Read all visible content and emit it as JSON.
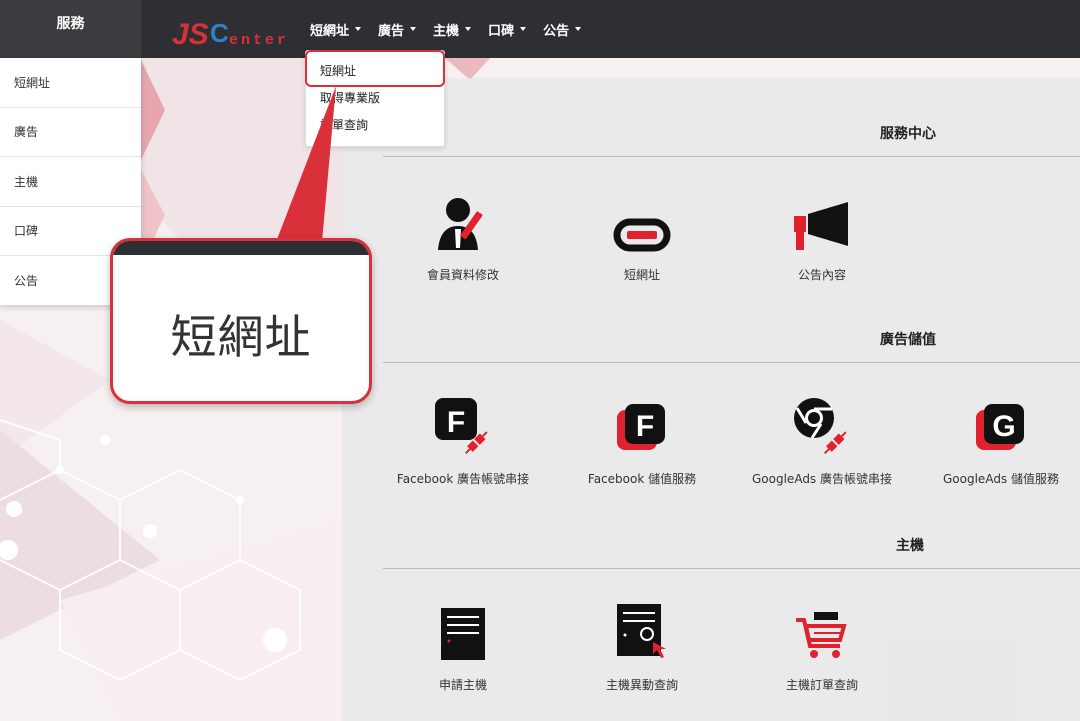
{
  "topbar": {
    "sidebar_title": "服務",
    "logo_text_1": "JS",
    "logo_text_2": "C",
    "logo_text_3": "enter",
    "nav": [
      {
        "label": "短網址"
      },
      {
        "label": "廣告"
      },
      {
        "label": "主機"
      },
      {
        "label": "口碑"
      },
      {
        "label": "公告"
      }
    ]
  },
  "sidebar": {
    "items": [
      {
        "label": "短網址"
      },
      {
        "label": "廣告"
      },
      {
        "label": "主機"
      },
      {
        "label": "口碑"
      },
      {
        "label": "公告"
      }
    ]
  },
  "dropdown": {
    "items": [
      {
        "label": "短網址"
      },
      {
        "label": "取得專業版"
      },
      {
        "label": "訂單查詢"
      }
    ]
  },
  "callout": {
    "text": "短網址"
  },
  "sections": [
    {
      "title": "服務中心",
      "tiles": [
        {
          "label": "會員資料修改",
          "icon": "user-edit-icon"
        },
        {
          "label": "短網址",
          "icon": "link-icon"
        },
        {
          "label": "公告內容",
          "icon": "megaphone-icon"
        }
      ]
    },
    {
      "title": "廣告儲值",
      "tiles": [
        {
          "label": "Facebook 廣告帳號串接",
          "icon": "facebook-plug-icon"
        },
        {
          "label": "Facebook 儲值服務",
          "icon": "facebook-icon"
        },
        {
          "label": "GoogleAds 廣告帳號串接",
          "icon": "google-ads-plug-icon"
        },
        {
          "label": "GoogleAds 儲值服務",
          "icon": "google-icon"
        }
      ]
    },
    {
      "title": "主機",
      "tiles": [
        {
          "label": "申請主機",
          "icon": "server-icon"
        },
        {
          "label": "主機異動查詢",
          "icon": "server-refresh-icon"
        },
        {
          "label": "主機訂單查詢",
          "icon": "cart-icon"
        }
      ]
    }
  ],
  "colors": {
    "accent": "#d9303a",
    "topbar": "#2d2f33",
    "logo_blue": "#2f80c8"
  }
}
